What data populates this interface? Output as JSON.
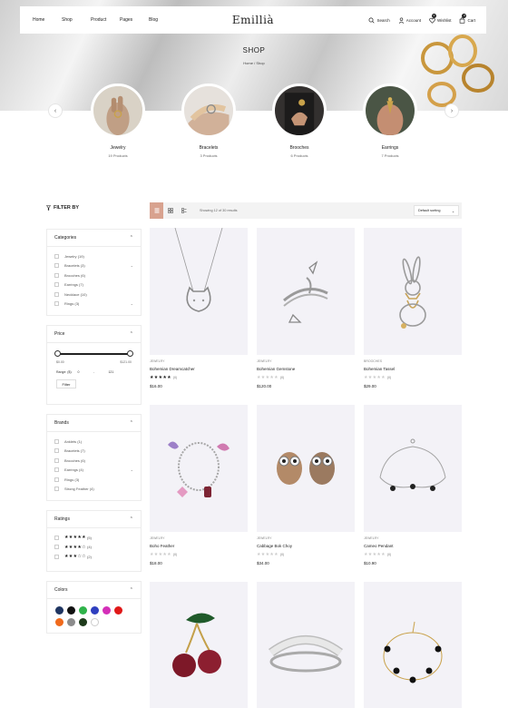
{
  "nav": {
    "items": [
      "Home",
      "Shop",
      "Product",
      "Pages",
      "Blog"
    ],
    "logo": "Emillià",
    "search": "Search",
    "account": "Account",
    "wishlist": "Wishlist",
    "wishlist_count": "0",
    "cart": "Cart",
    "cart_count": "0"
  },
  "hero": {
    "title": "SHOP",
    "breadcrumb": [
      "Home",
      "/",
      "Shop"
    ]
  },
  "categories": [
    {
      "name": "Jewelry",
      "count": "19 Products"
    },
    {
      "name": "Bracelets",
      "count": "3 Products"
    },
    {
      "name": "Brooches",
      "count": "6 Products"
    },
    {
      "name": "Earrings",
      "count": "7 Products"
    }
  ],
  "sidebar": {
    "filter_title": "FILTER BY",
    "categories": {
      "title": "Categories",
      "items": [
        {
          "label": "Jewelry",
          "count": "(19)"
        },
        {
          "label": "Bracelets",
          "count": "(3)"
        },
        {
          "label": "Brooches",
          "count": "(6)"
        },
        {
          "label": "Earrings",
          "count": "(7)"
        },
        {
          "label": "Necklace",
          "count": "(10)"
        },
        {
          "label": "Rings",
          "count": "(3)"
        }
      ]
    },
    "price": {
      "title": "Price",
      "min": "$0.00",
      "max": "$121.00",
      "range_label": "Range: ($):",
      "from": "0",
      "to": "121",
      "filter_label": "Filter"
    },
    "brands": {
      "title": "Brands",
      "items": [
        {
          "label": "Anklets",
          "count": "(1)"
        },
        {
          "label": "Bracelets",
          "count": "(7)"
        },
        {
          "label": "Brooches",
          "count": "(6)"
        },
        {
          "label": "Earrings",
          "count": "(4)"
        },
        {
          "label": "Rings",
          "count": "(3)"
        },
        {
          "label": "Strong Feather",
          "count": "(4)"
        }
      ]
    },
    "ratings": {
      "title": "Ratings",
      "items": [
        {
          "stars": "★★★★★",
          "count": "(5)"
        },
        {
          "stars": "★★★★☆",
          "count": "(4)"
        },
        {
          "stars": "★★★☆☆",
          "count": "(2)"
        }
      ]
    },
    "colors": {
      "title": "Colors",
      "swatches": [
        "#1f3561",
        "#111111",
        "#2fb34a",
        "#2f3fbf",
        "#d42fb8",
        "#e01818",
        "#f06a1c",
        "#8c8c8c",
        "#1d3a1a",
        "#ffffff"
      ]
    }
  },
  "toolbar": {
    "showing": "Showing 12 of 30 results",
    "sort": "Default sorting"
  },
  "products": [
    {
      "brand": "JEWELRY",
      "name": "Bohemian Dreamcatcher",
      "reviews": "(0)",
      "price": "$16.00"
    },
    {
      "brand": "JEWELRY",
      "name": "Bohemian Gemstone",
      "reviews": "(0)",
      "price": "$120.00"
    },
    {
      "brand": "BROOCHES",
      "name": "Bohemian Tassel",
      "reviews": "(0)",
      "price": "$29.00"
    },
    {
      "brand": "JEWELRY",
      "name": "Boho Feather",
      "reviews": "(0)",
      "price": "$18.00"
    },
    {
      "brand": "JEWELRY",
      "name": "Cabbage Bok Choy",
      "reviews": "(0)",
      "price": "$34.00"
    },
    {
      "brand": "JEWELRY",
      "name": "Cameo Pendant",
      "reviews": "(0)",
      "price": "$10.90"
    },
    {
      "brand": "",
      "name": "",
      "reviews": "",
      "price": ""
    },
    {
      "brand": "",
      "name": "",
      "reviews": "",
      "price": ""
    },
    {
      "brand": "",
      "name": "",
      "reviews": "",
      "price": ""
    }
  ],
  "icons": [
    "search-icon",
    "account-icon",
    "heart-icon",
    "cart-icon",
    "chevron-left-icon",
    "chevron-right-icon",
    "filter-icon",
    "chevron-up-icon",
    "chevron-down-icon",
    "list-view-icon",
    "grid-view-icon",
    "compact-view-icon"
  ],
  "accent": "#d8a28f"
}
